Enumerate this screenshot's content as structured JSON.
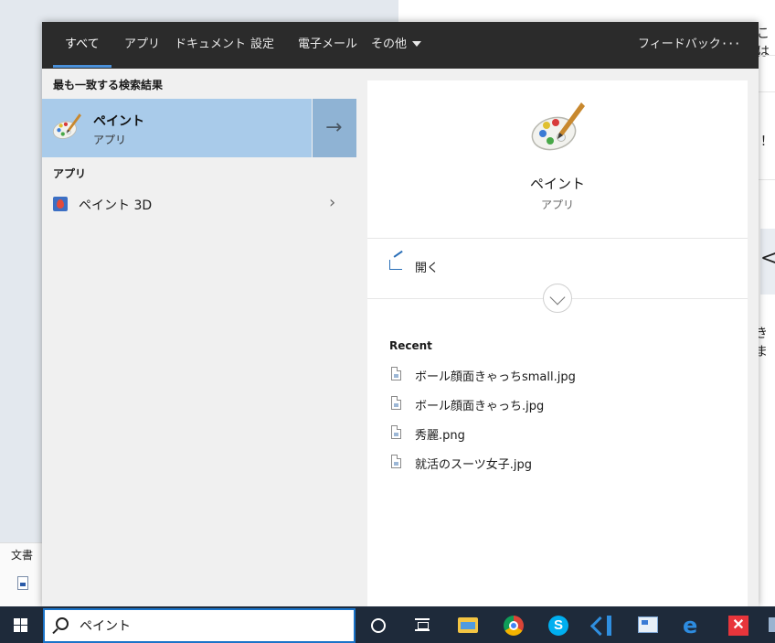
{
  "background": {
    "right_fragments": [
      "こは",
      "！",
      "<",
      "きま"
    ],
    "doc_tab": "文書"
  },
  "tabs": [
    {
      "label": "すべて",
      "active": true
    },
    {
      "label": "アプリ"
    },
    {
      "label": "ドキュメント"
    },
    {
      "label": "設定"
    },
    {
      "label": "電子メール"
    },
    {
      "label": "その他"
    }
  ],
  "feedback_label": "フィードバック",
  "more_options": "···",
  "best_match": {
    "heading": "最も一致する検索結果",
    "title": "ペイント",
    "subtitle": "アプリ",
    "arrow": "→"
  },
  "apps_section": {
    "heading": "アプリ",
    "items": [
      {
        "label": "ペイント 3D",
        "chevron": "›"
      }
    ]
  },
  "detail": {
    "title": "ペイント",
    "kind": "アプリ",
    "open_label": "開く",
    "recent_heading": "Recent",
    "recent_files": [
      "ボール顔面きゃっちsmall.jpg",
      "ボール顔面きゃっち.jpg",
      "秀麗.png",
      "就活のスーツ女子.jpg"
    ]
  },
  "taskbar": {
    "search_value": "ペイント",
    "icons": [
      "cortana-icon",
      "task-view-icon",
      "file-explorer-icon",
      "chrome-icon",
      "skype-icon",
      "vscode-icon",
      "control-panel-icon",
      "edge-icon",
      "xmind-icon"
    ]
  }
}
